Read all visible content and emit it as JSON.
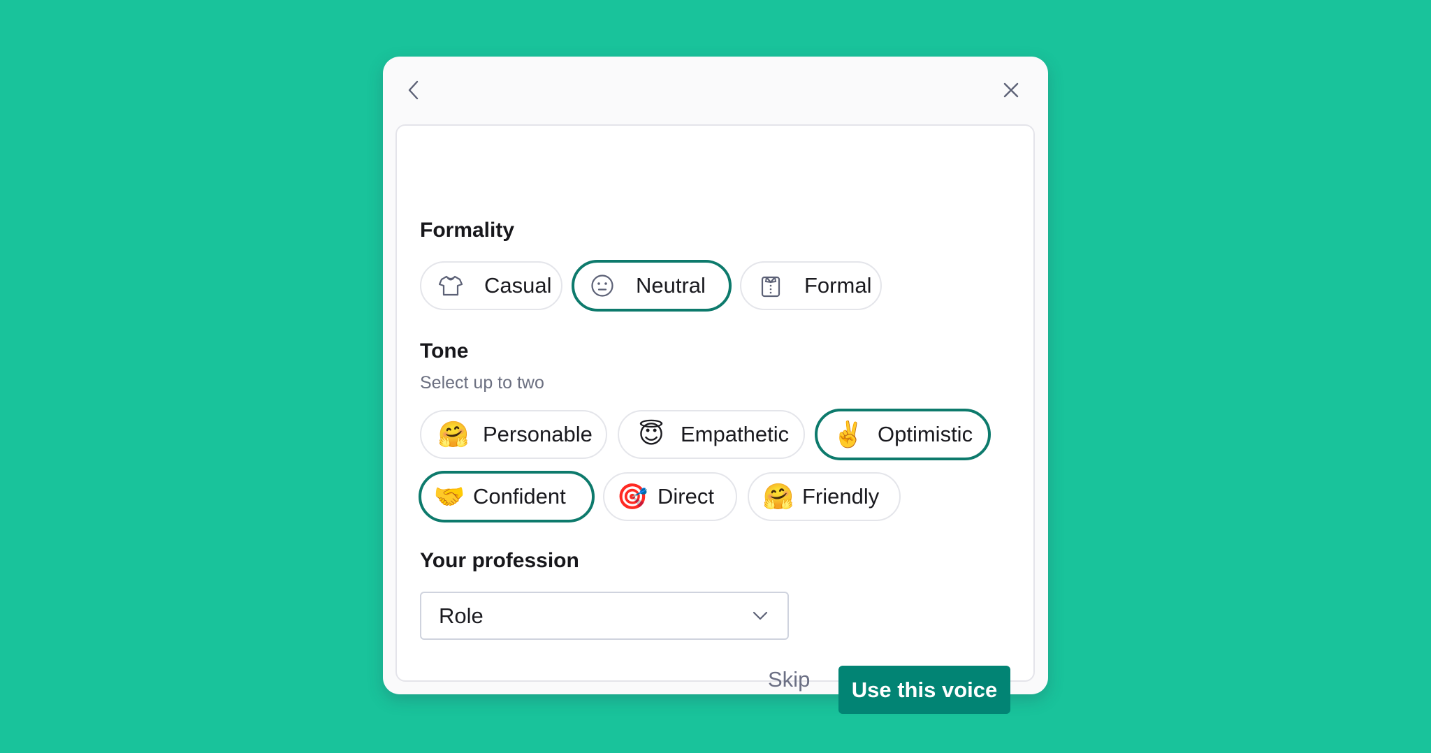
{
  "dialog": {
    "back_icon": "chevron-left-icon",
    "close_icon": "close-icon"
  },
  "formality": {
    "title": "Formality",
    "options": [
      {
        "label": "Casual",
        "icon": "tshirt-icon",
        "selected": false
      },
      {
        "label": "Neutral",
        "icon": "neutral-face-icon",
        "selected": true
      },
      {
        "label": "Formal",
        "icon": "dress-shirt-icon",
        "selected": false
      }
    ]
  },
  "tone": {
    "title": "Tone",
    "subtitle": "Select up to two",
    "options": [
      {
        "label": "Personable",
        "emoji": "🤗",
        "selected": false
      },
      {
        "label": "Empathetic",
        "emoji": "😇",
        "selected": false
      },
      {
        "label": "Optimistic",
        "emoji": "✌️",
        "selected": true
      },
      {
        "label": "Confident",
        "emoji": "🤝",
        "selected": true
      },
      {
        "label": "Direct",
        "emoji": "🎯",
        "selected": false
      },
      {
        "label": "Friendly",
        "emoji": "🤗",
        "selected": false
      }
    ]
  },
  "profession": {
    "title": "Your profession",
    "select_value": "Role"
  },
  "actions": {
    "skip_label": "Skip",
    "primary_label": "Use this voice"
  },
  "colors": {
    "background": "#19c39b",
    "accent": "#028474",
    "selected_border": "#0d7a6c"
  }
}
